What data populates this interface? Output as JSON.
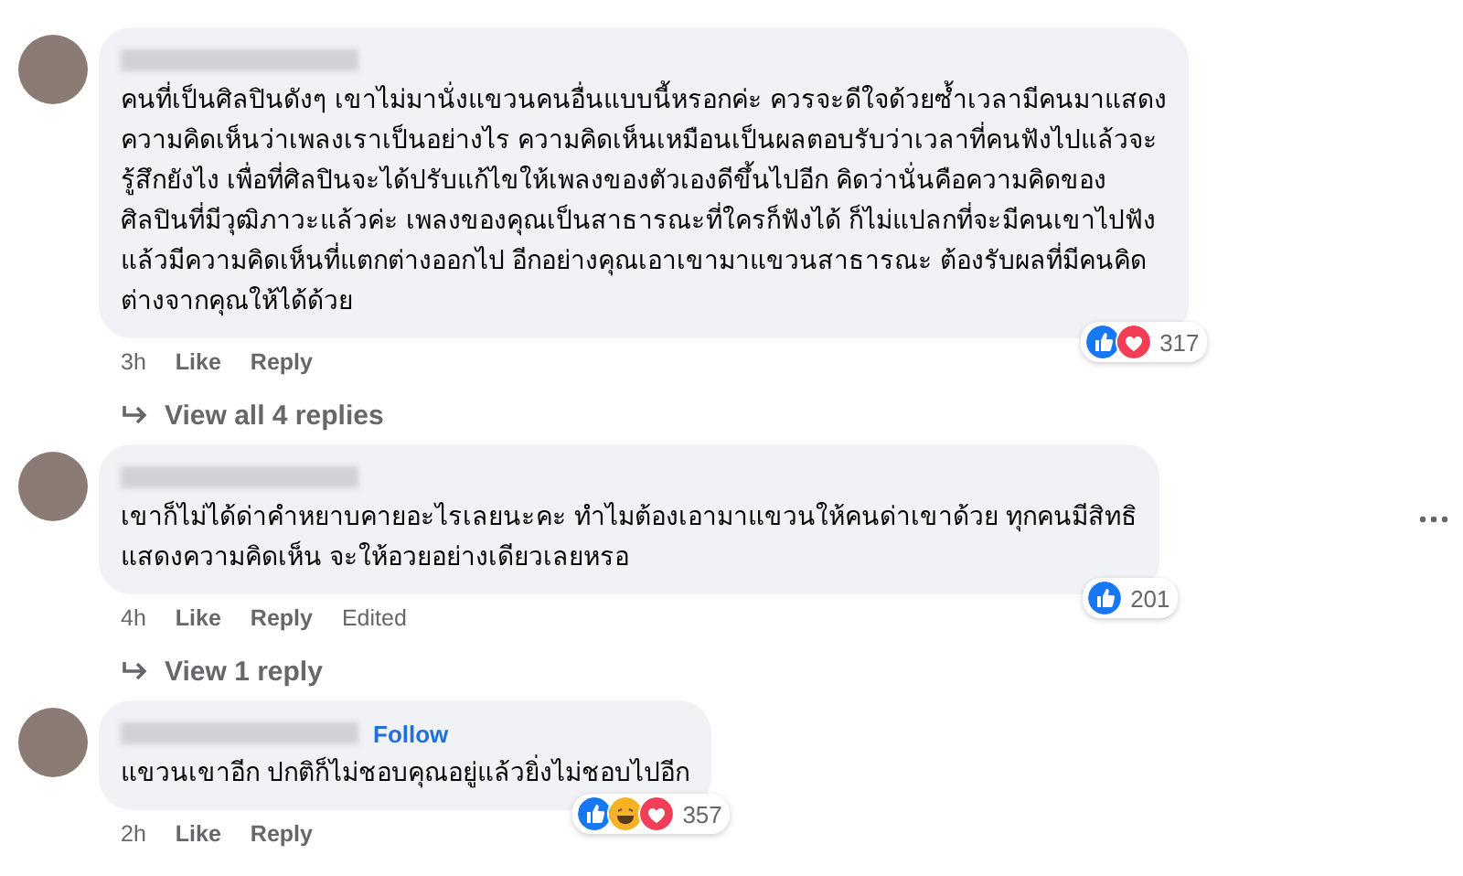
{
  "comments": [
    {
      "more_menu": false,
      "text": "คนที่เป็นศิลปินดังๆ เขาไม่มานั่งแขวนคนอื่นแบบนี้หรอกค่ะ ควรจะดีใจด้วยซ้ำเวลามีคนมาแสดง\nความคิดเห็นว่าเพลงเราเป็นอย่างไร ความคิดเห็นเหมือนเป็นผลตอบรับว่าเวลาที่คนฟังไปแล้วจะ\nรู้สึกยังไง เพื่อที่ศิลปินจะได้ปรับแก้ไขให้เพลงของตัวเองดีขึ้นไปอีก คิดว่านั่นคือความคิดของ\nศิลปินที่มีวุฒิภาวะแล้วค่ะ เพลงของคุณเป็นสาธารณะที่ใครก็ฟังได้ ก็ไม่แปลกที่จะมีคนเขาไปฟัง\nแล้วมีความคิดเห็นที่แตกต่างออกไป อีกอย่างคุณเอาเขามาแขวนสาธารณะ ต้องรับผลที่มีคนคิด\nต่างจากคุณให้ได้ด้วย",
      "reactions": [
        {
          "kind": "like"
        },
        {
          "kind": "love"
        }
      ],
      "reaction_count": "317",
      "time": "3h",
      "like": "Like",
      "reply": "Reply",
      "replies_link": "View all 4 replies"
    },
    {
      "more_menu": true,
      "text": "เขาก็ไม่ได้ด่าคำหยาบคายอะไรเลยนะคะ ทำไมต้องเอามาแขวนให้คนด่าเขาด้วย ทุกคนมีสิทธิ\nแสดงความคิดเห็น จะให้อวยอย่างเดียวเลยหรอ",
      "reactions": [
        {
          "kind": "like"
        }
      ],
      "reaction_count": "201",
      "time": "4h",
      "like": "Like",
      "reply": "Reply",
      "edited": "Edited",
      "replies_link": "View 1 reply"
    },
    {
      "follow": "Follow",
      "more_menu": false,
      "text": "แขวนเขาอีก ปกติก็ไม่ชอบคุณอยู่แล้วยิ่งไม่ชอบไปอีก",
      "reactions": [
        {
          "kind": "like"
        },
        {
          "kind": "haha"
        },
        {
          "kind": "love"
        }
      ],
      "reaction_count": "357",
      "time": "2h",
      "like": "Like",
      "reply": "Reply"
    }
  ]
}
